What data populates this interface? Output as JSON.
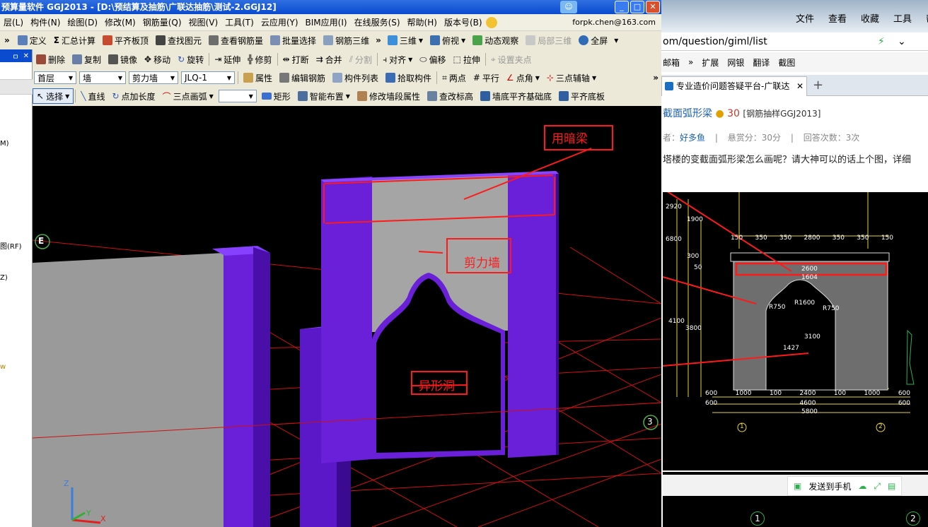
{
  "app": {
    "title": "预算量软件 GGJ2013 - [D:\\预结算及抽筋\\广联达抽筋\\测试-2.GGJ12]",
    "help_glyph": "☺",
    "window_buttons": {
      "minimize": "_",
      "maximize": "□",
      "close": "✕"
    },
    "menu": [
      "层(L)",
      "构件(N)",
      "绘图(D)",
      "修改(M)",
      "钢筋量(Q)",
      "视图(V)",
      "工具(T)",
      "云应用(Y)",
      "BIM应用(I)",
      "在线服务(S)",
      "帮助(H)",
      "版本号(B)"
    ],
    "user_email": "forpk.chen@163.com",
    "toolbar1": [
      "定义",
      "汇总计算",
      "平齐板顶",
      "查找图元",
      "查看钢筋量",
      "批量选择",
      "钢筋三维",
      "三维",
      "俯视",
      "动态观察",
      "局部三维",
      "全屏"
    ],
    "toolbar2": [
      "删除",
      "复制",
      "镜像",
      "移动",
      "旋转",
      "延伸",
      "修剪",
      "打断",
      "合并",
      "分割",
      "对齐",
      "偏移",
      "拉伸",
      "设置夹点"
    ],
    "toolbar3": {
      "floor": "首层",
      "type": "墙",
      "subtype": "剪力墙",
      "component": "JLQ-1",
      "buttons": [
        "属性",
        "编辑钢筋",
        "构件列表",
        "拾取构件",
        "两点",
        "平行",
        "点角",
        "三点辅轴"
      ]
    },
    "toolbar4": [
      "选择",
      "直线",
      "点加长度",
      "三点画弧",
      "矩形",
      "智能布置",
      "修改墙段属性",
      "查改标高",
      "墙底平齐基础底",
      "平齐底板"
    ],
    "overflow_chevron": "»",
    "left_panel": {
      "header_pin": "ㅁ",
      "header_close": "✕",
      "items": [
        "M)",
        "图(RF)",
        "Z)",
        "w"
      ]
    },
    "viewport": {
      "axis_markers": [
        "E",
        "3"
      ],
      "annotations": [
        "用暗梁",
        "剪力墙",
        "异形洞"
      ],
      "coord_labels": [
        "Z",
        "Y",
        "X"
      ]
    }
  },
  "browser": {
    "menu": [
      "文件",
      "查看",
      "收藏",
      "工具",
      "帮"
    ],
    "url": "om/question/giml/list",
    "bookmarks": [
      "邮箱",
      "扩展",
      "网银",
      "翻译",
      "截图"
    ],
    "tab_title": "专业造价问题答疑平台-广联达",
    "tab_close": "✕",
    "tab_add": "+",
    "question": {
      "title": "截面弧形梁",
      "points": "30",
      "tag": "[钢筋抽样GGJ2013]",
      "asker_label": "者：",
      "asker": "好多鱼",
      "reward": "悬赏分：30分",
      "answers": "回答次数：3次",
      "body": "塔楼的变截面弧形梁怎么画呢？请大神可以的话上个图，详细"
    },
    "cad_labels": {
      "dims_top": [
        "150",
        "350",
        "350",
        "2800",
        "350",
        "350",
        "150"
      ],
      "beam": "2600",
      "arc_radius": [
        "R750",
        "R1600",
        "R750"
      ],
      "inner": [
        "1604",
        "3100",
        "1427"
      ],
      "heights": [
        "2920",
        "1900",
        "300",
        "50",
        "4100",
        "3800",
        "6800"
      ],
      "dims_bottom": [
        "600",
        "1000",
        "100",
        "2400",
        "100",
        "1000",
        "600"
      ],
      "dims_bottom2": [
        "600",
        "4600",
        "600"
      ],
      "total": "5800",
      "grid_marks": [
        "1",
        "2"
      ]
    },
    "send_to_phone": "发送到手机",
    "bottom_grid_marks": [
      "1",
      "2"
    ]
  }
}
